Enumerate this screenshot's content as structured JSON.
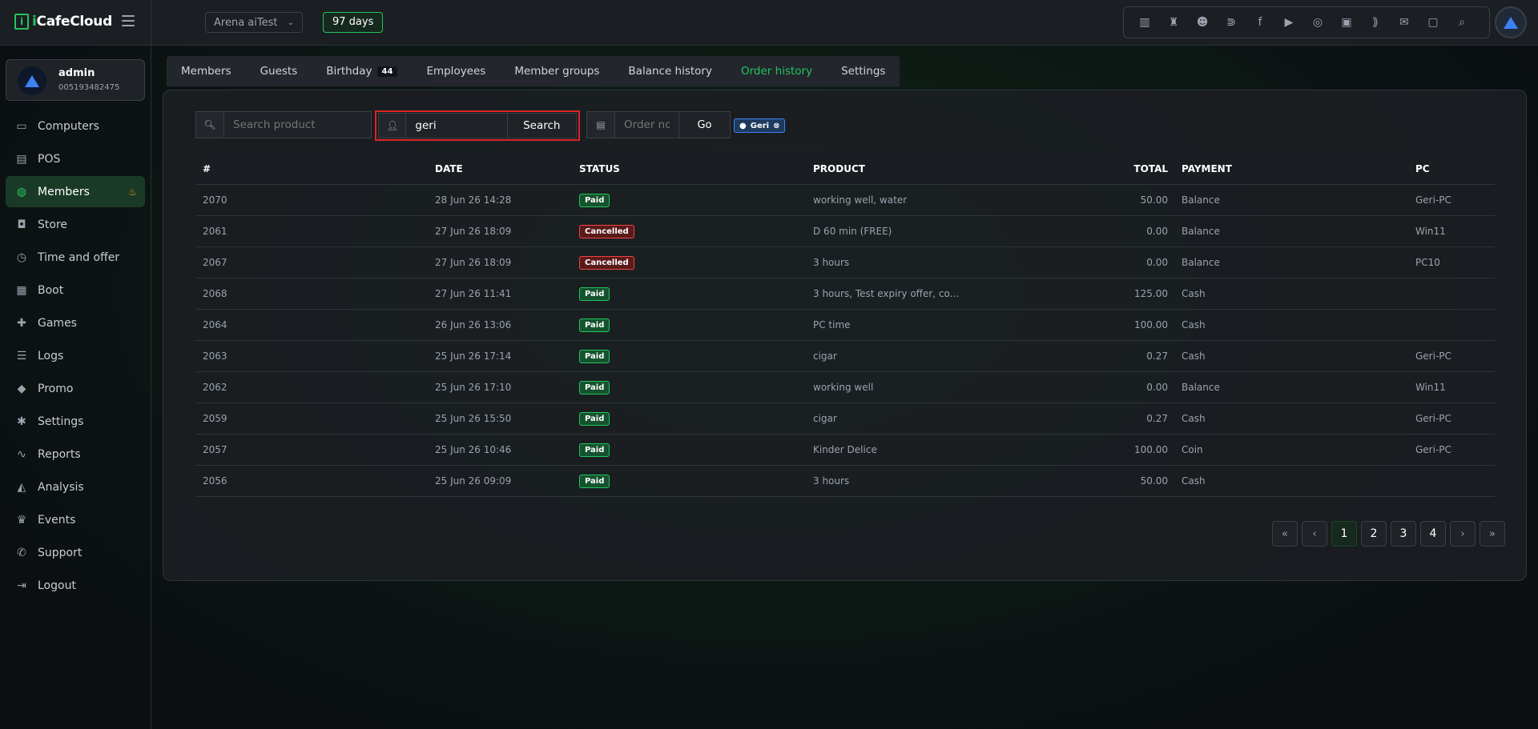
{
  "app": {
    "name_prefix": "i",
    "name_main": "CafeCloud",
    "logo_mark": "i"
  },
  "topbar": {
    "cafe_select": "Arena aiTest",
    "days_badge": "97 days",
    "icons": [
      "leaderboard-icon",
      "trophy-icon",
      "users-icon",
      "rss-icon",
      "facebook-icon",
      "youtube-icon",
      "globe-icon",
      "icafe-icon",
      "handshake-icon",
      "mail-icon",
      "chat-icon",
      "search-icon"
    ]
  },
  "user": {
    "name": "admin",
    "id": "005193482475"
  },
  "sidebar": {
    "items": [
      {
        "label": "Computers",
        "icon": "monitor-icon",
        "glyph": "▭"
      },
      {
        "label": "POS",
        "icon": "register-icon",
        "glyph": "▤"
      },
      {
        "label": "Members",
        "icon": "members-icon",
        "glyph": "◍",
        "active": true
      },
      {
        "label": "Store",
        "icon": "bag-icon",
        "glyph": "◘"
      },
      {
        "label": "Time and offer",
        "icon": "stopwatch-icon",
        "glyph": "◷"
      },
      {
        "label": "Boot",
        "icon": "windows-icon",
        "glyph": "▦"
      },
      {
        "label": "Games",
        "icon": "gamepad-icon",
        "glyph": "✚"
      },
      {
        "label": "Logs",
        "icon": "list-icon",
        "glyph": "☰"
      },
      {
        "label": "Promo",
        "icon": "tag-icon",
        "glyph": "◆"
      },
      {
        "label": "Settings",
        "icon": "gear-icon",
        "glyph": "✱"
      },
      {
        "label": "Reports",
        "icon": "line-chart-icon",
        "glyph": "∿"
      },
      {
        "label": "Analysis",
        "icon": "area-chart-icon",
        "glyph": "◭"
      },
      {
        "label": "Events",
        "icon": "crown-icon",
        "glyph": "♛"
      },
      {
        "label": "Support",
        "icon": "phone-icon",
        "glyph": "✆"
      },
      {
        "label": "Logout",
        "icon": "logout-icon",
        "glyph": "⇥"
      }
    ]
  },
  "tabs": [
    {
      "label": "Members"
    },
    {
      "label": "Guests"
    },
    {
      "label": "Birthday",
      "badge": "44"
    },
    {
      "label": "Employees"
    },
    {
      "label": "Member groups"
    },
    {
      "label": "Balance history"
    },
    {
      "label": "Order history",
      "active": true
    },
    {
      "label": "Settings"
    }
  ],
  "filters": {
    "product_placeholder": "Search product",
    "user_value": "geri",
    "search_button": "Search",
    "order_placeholder": "Order no.",
    "go_button": "Go",
    "chip_label": "Geri"
  },
  "table": {
    "headers": {
      "num": "#",
      "date": "DATE",
      "status": "STATUS",
      "product": "PRODUCT",
      "total": "TOTAL",
      "payment": "PAYMENT",
      "pc": "PC"
    },
    "rows": [
      {
        "num": "2070",
        "date": "28 Jun 26 14:28",
        "status": "Paid",
        "product": "working well, water",
        "total": "50.00",
        "payment": "Balance",
        "pc": "Geri-PC"
      },
      {
        "num": "2061",
        "date": "27 Jun 26 18:09",
        "status": "Cancelled",
        "product": "D 60 min (FREE)",
        "total": "0.00",
        "payment": "Balance",
        "pc": "Win11"
      },
      {
        "num": "2067",
        "date": "27 Jun 26 18:09",
        "status": "Cancelled",
        "product": "3 hours",
        "total": "0.00",
        "payment": "Balance",
        "pc": "PC10"
      },
      {
        "num": "2068",
        "date": "27 Jun 26 11:41",
        "status": "Paid",
        "product": "3 hours, Test expiry offer, co...",
        "total": "125.00",
        "payment": "Cash",
        "pc": ""
      },
      {
        "num": "2064",
        "date": "26 Jun 26 13:06",
        "status": "Paid",
        "product": "PC time",
        "total": "100.00",
        "payment": "Cash",
        "pc": ""
      },
      {
        "num": "2063",
        "date": "25 Jun 26 17:14",
        "status": "Paid",
        "product": "cigar",
        "total": "0.27",
        "payment": "Cash",
        "pc": "Geri-PC"
      },
      {
        "num": "2062",
        "date": "25 Jun 26 17:10",
        "status": "Paid",
        "product": "working well",
        "total": "0.00",
        "payment": "Balance",
        "pc": "Win11"
      },
      {
        "num": "2059",
        "date": "25 Jun 26 15:50",
        "status": "Paid",
        "product": "cigar",
        "total": "0.27",
        "payment": "Cash",
        "pc": "Geri-PC"
      },
      {
        "num": "2057",
        "date": "25 Jun 26 10:46",
        "status": "Paid",
        "product": "Kinder Delice",
        "total": "100.00",
        "payment": "Coin",
        "pc": "Geri-PC"
      },
      {
        "num": "2056",
        "date": "25 Jun 26 09:09",
        "status": "Paid",
        "product": "3 hours",
        "total": "50.00",
        "payment": "Cash",
        "pc": ""
      }
    ]
  },
  "pagination": {
    "first": "«",
    "prev": "‹",
    "next": "›",
    "last": "»",
    "pages": [
      "1",
      "2",
      "3",
      "4"
    ],
    "current": "1"
  },
  "colors": {
    "accent": "#22c55e",
    "danger": "#ef4444",
    "highlight_border": "#dc2626"
  }
}
